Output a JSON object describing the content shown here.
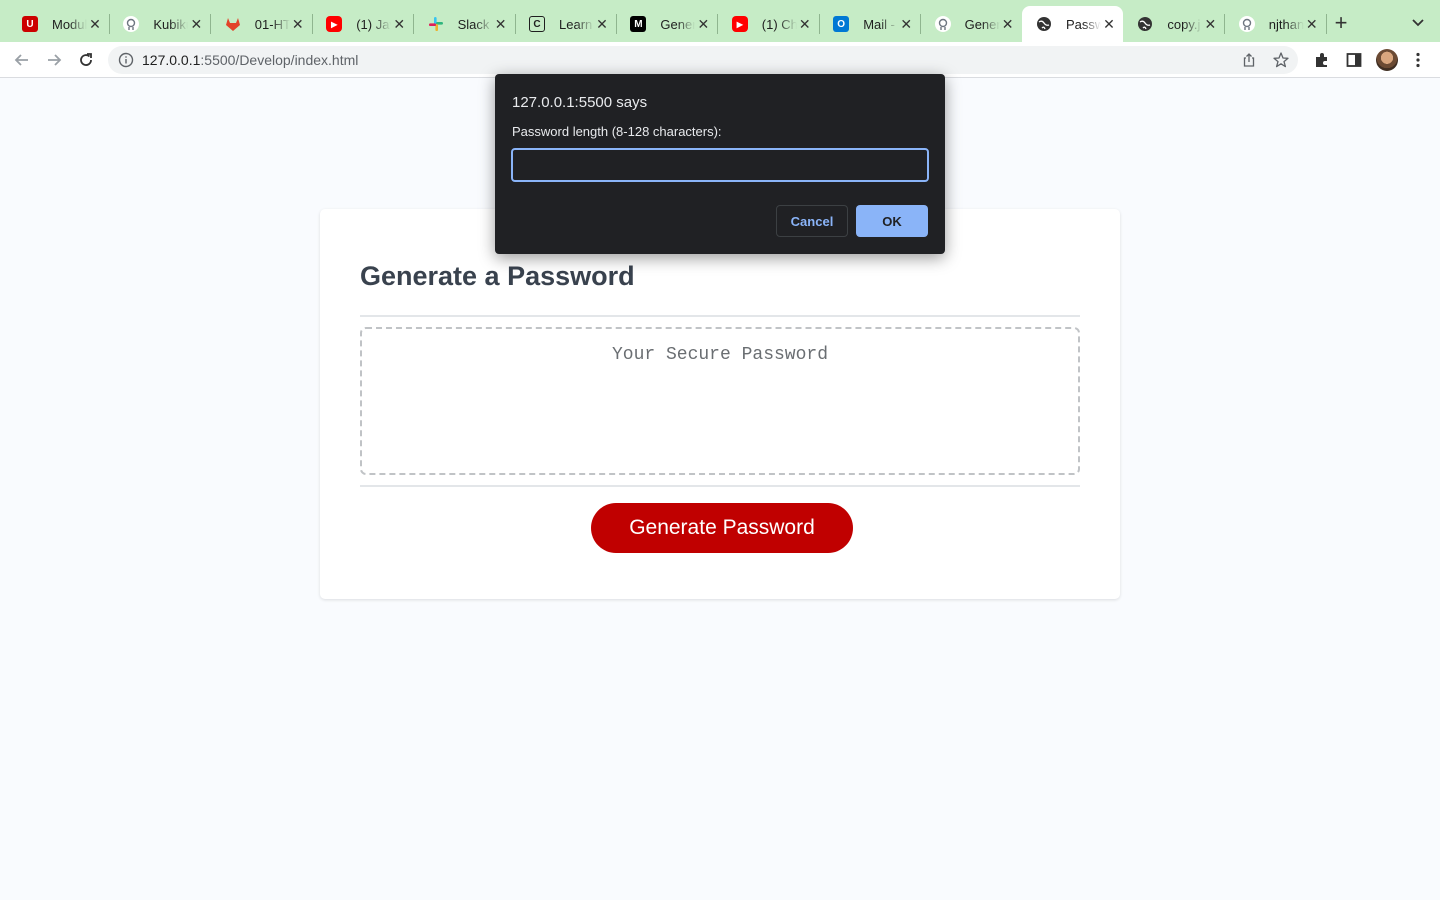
{
  "tabs": [
    {
      "title": "Modul",
      "icon": "utah-u-icon",
      "color": "#cc0000"
    },
    {
      "title": "Kubiku",
      "icon": "github-icon",
      "color": "#ffffff"
    },
    {
      "title": "01-HT",
      "icon": "gitlab-icon",
      "color": "#e24329"
    },
    {
      "title": "(1) Jav",
      "icon": "youtube-icon",
      "color": "#ff0000"
    },
    {
      "title": "Slack |",
      "icon": "slack-icon",
      "color": "#4a154b"
    },
    {
      "title": "Learn",
      "icon": "learn-icon",
      "color": "#1f1f1f"
    },
    {
      "title": "Gener",
      "icon": "medium-icon",
      "color": "#000000"
    },
    {
      "title": "(1) Ch",
      "icon": "youtube-icon",
      "color": "#ff0000"
    },
    {
      "title": "Mail -",
      "icon": "outlook-icon",
      "color": "#0078d4"
    },
    {
      "title": "Gener",
      "icon": "github-icon",
      "color": "#ffffff"
    },
    {
      "title": "Passw",
      "icon": "globe-icon",
      "color": "#1f1f1f",
      "active": true
    },
    {
      "title": "copy.j",
      "icon": "globe-icon",
      "color": "#1f1f1f"
    },
    {
      "title": "njthan",
      "icon": "github-icon",
      "color": "#ffffff"
    }
  ],
  "browser": {
    "url_host": "127.0.0.1",
    "url_rest": ":5500/Develop/index.html"
  },
  "dialog": {
    "title": "127.0.0.1:5500 says",
    "message": "Password length (8-128 characters):",
    "input_value": "",
    "cancel_label": "Cancel",
    "ok_label": "OK"
  },
  "page": {
    "heading": "Generate a Password",
    "password_placeholder": "Your Secure Password",
    "generate_label": "Generate Password"
  },
  "colors": {
    "tabstrip": "#c6ecc6",
    "primary_button": "#c00000",
    "dialog_bg": "#202124",
    "dialog_accent": "#8ab4f8"
  }
}
